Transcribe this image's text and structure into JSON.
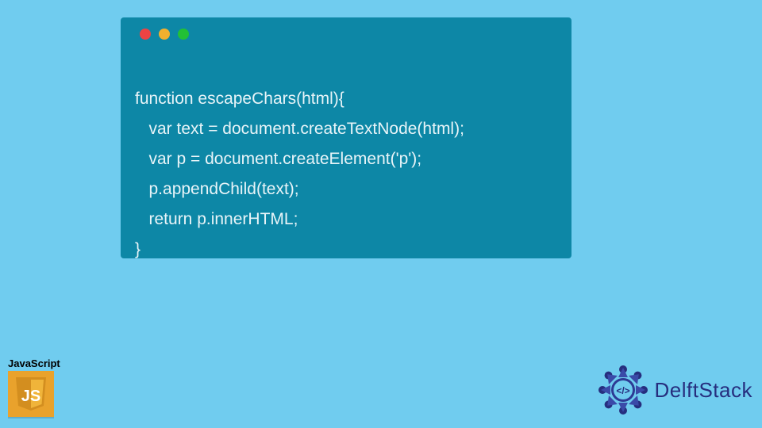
{
  "code": {
    "lines": [
      "function escapeChars(html){",
      "   var text = document.createTextNode(html);",
      "   var p = document.createElement('p');",
      "   p.appendChild(text);",
      "   return p.innerHTML;",
      "}"
    ]
  },
  "badges": {
    "js_label": "JavaScript",
    "js_logo_text": "JS",
    "delft_text": "DelftStack"
  },
  "colors": {
    "background": "#70ccef",
    "window": "#0d87a6",
    "code_text": "#e8f4f8",
    "js_logo": "#e9a22c",
    "delft_brand": "#262e7e"
  }
}
